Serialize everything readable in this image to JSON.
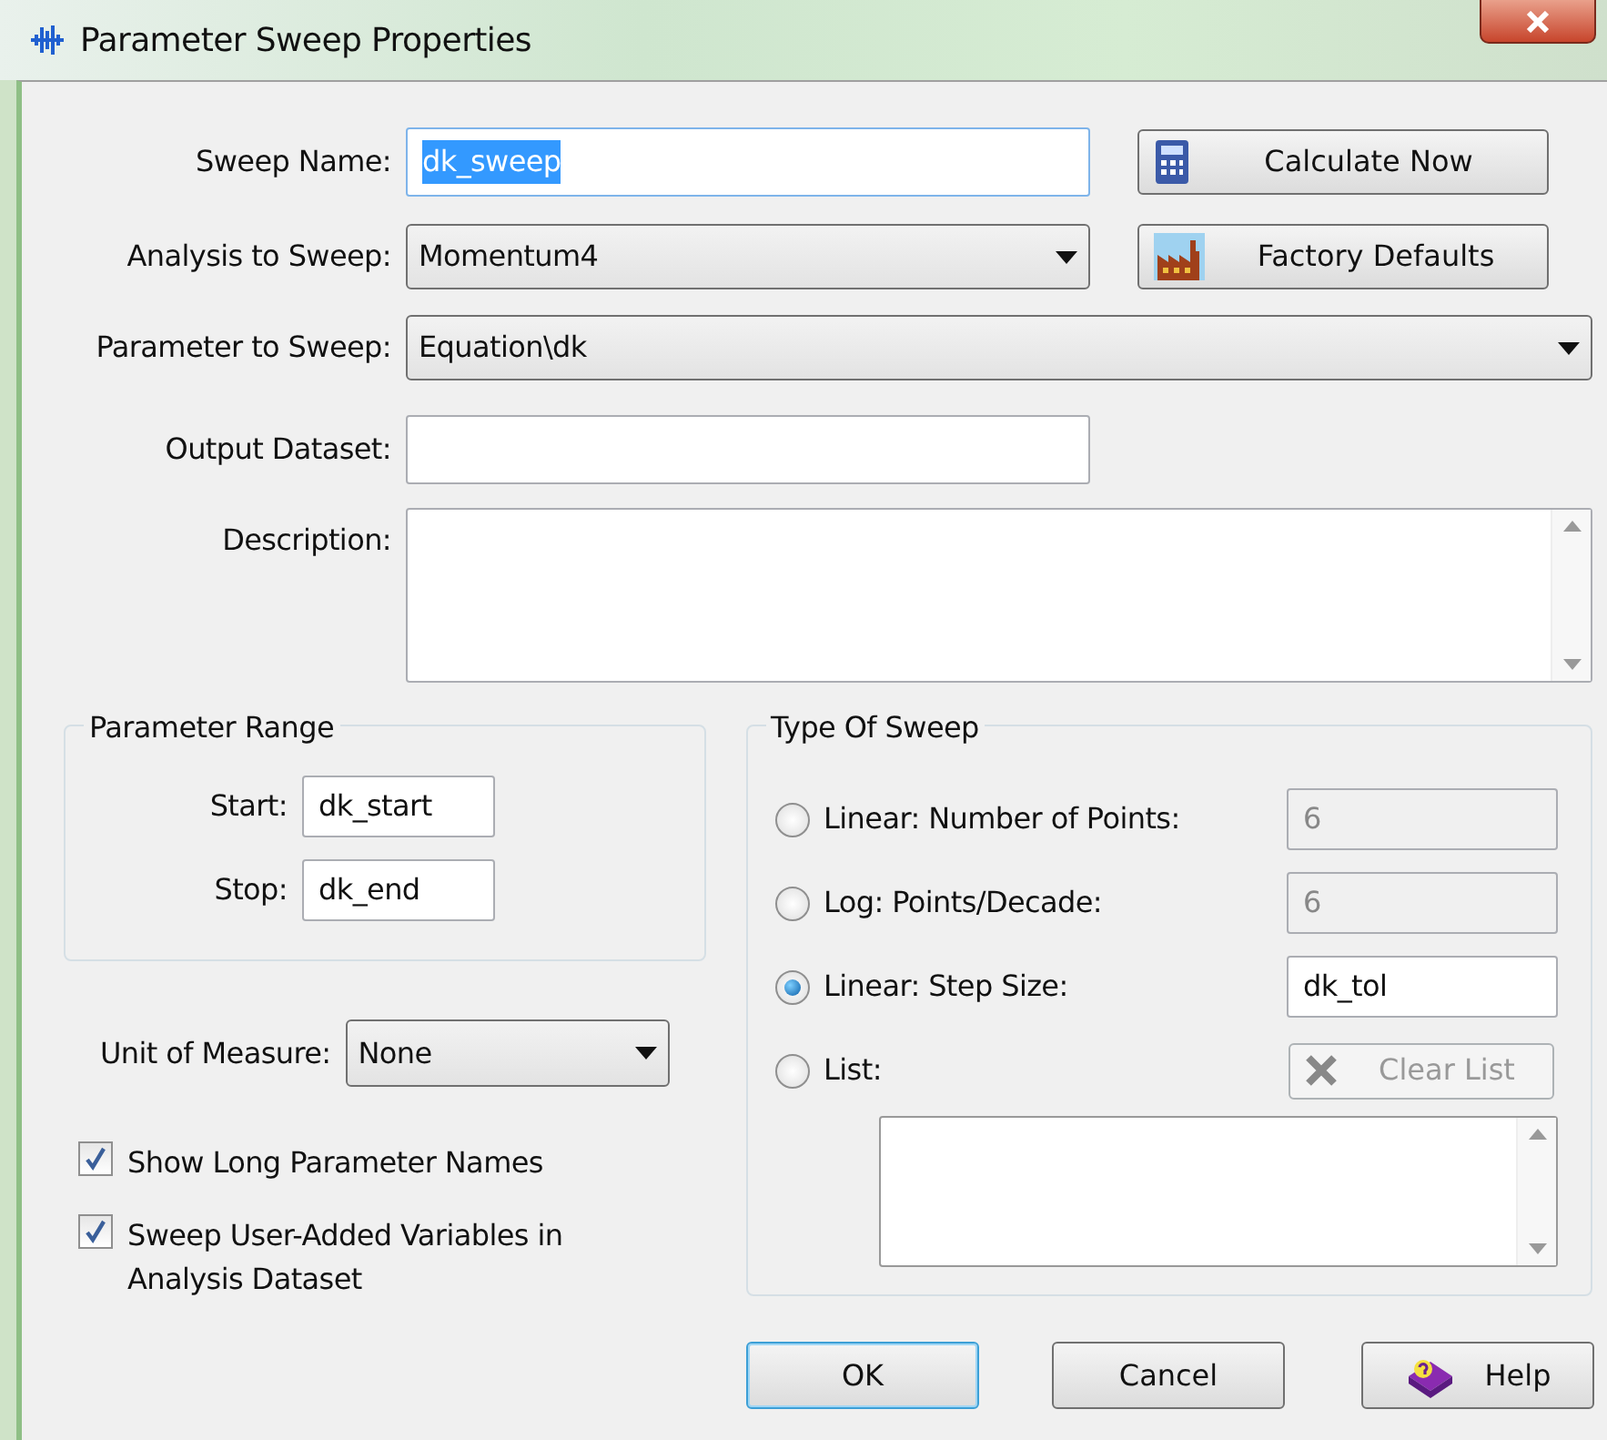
{
  "window": {
    "title": "Parameter Sweep Properties"
  },
  "sweep_name": {
    "label": "Sweep Name:",
    "value": "dk_sweep",
    "highlighted": true
  },
  "analysis": {
    "label": "Analysis to Sweep:",
    "value": "Momentum4"
  },
  "parameter": {
    "label": "Parameter to Sweep:",
    "value": "Equation\\dk"
  },
  "output_dataset": {
    "label": "Output Dataset:"
  },
  "description": {
    "label": "Description:"
  },
  "side_buttons": [
    {
      "label": "Calculate Now",
      "kind": "calculator"
    },
    {
      "label": "Factory Defaults",
      "kind": "factory"
    }
  ],
  "parameter_range": {
    "title": "Parameter Range",
    "fields": [
      {
        "label": "Start:",
        "value": "dk_start"
      },
      {
        "label": "Stop:",
        "value": "dk_end"
      }
    ]
  },
  "unit": {
    "label": "Unit of Measure:",
    "value": "None"
  },
  "options": [
    {
      "label": "Show Long Parameter Names",
      "checked": true
    },
    {
      "label": "Sweep User-Added Variables in Analysis Dataset",
      "checked": true
    }
  ],
  "type_of_sweep": {
    "title": "Type Of Sweep",
    "options": [
      {
        "kind": "field",
        "label": "Linear: Number of Points:",
        "selected": false,
        "value": "6",
        "disabled": true
      },
      {
        "kind": "field",
        "label": "Log: Points/Decade:",
        "selected": false,
        "value": "6",
        "disabled": true
      },
      {
        "kind": "field",
        "label": "Linear: Step Size:",
        "selected": true,
        "value": "dk_tol",
        "disabled": false
      },
      {
        "kind": "list",
        "label": "List:",
        "selected": false
      }
    ],
    "clear_button": {
      "label": "Clear List",
      "disabled": true
    }
  },
  "buttons": [
    {
      "label": "OK",
      "kind": "plain",
      "default": true
    },
    {
      "label": "Cancel",
      "kind": "plain",
      "default": false
    },
    {
      "label": "Help",
      "kind": "help",
      "default": false
    }
  ]
}
